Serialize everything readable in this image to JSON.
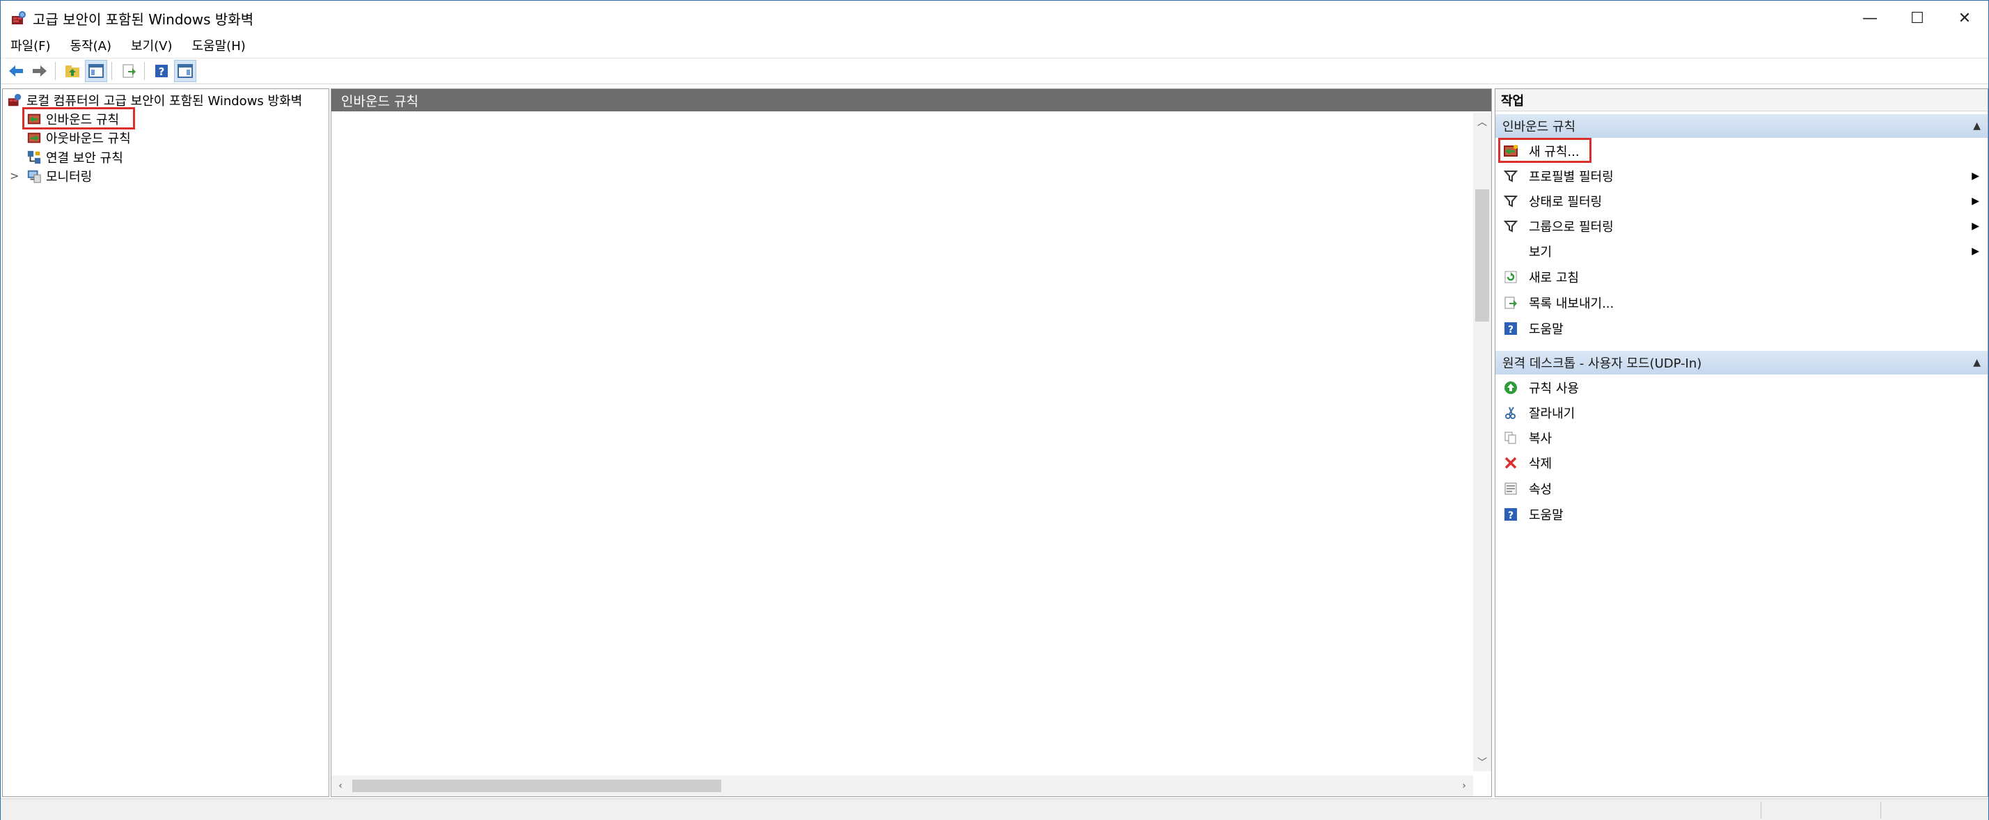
{
  "window": {
    "title": "고급 보안이 포함된 Windows 방화벽",
    "controls": {
      "minimize": "—",
      "maximize": "☐",
      "close": "✕"
    }
  },
  "menu": [
    "파일(F)",
    "동작(A)",
    "보기(V)",
    "도움말(H)"
  ],
  "tree": {
    "root": "로컬 컴퓨터의 고급 보안이 포함된 Windows 방화벽",
    "items": [
      {
        "label": "인바운드 규칙",
        "selected": true
      },
      {
        "label": "아웃바운드 규칙"
      },
      {
        "label": "연결 보안 규칙"
      },
      {
        "label": "모니터링",
        "expander": ">"
      }
    ]
  },
  "center": {
    "header": "인바운드 규칙"
  },
  "actions": {
    "title": "작업",
    "section1": {
      "title": "인바운드 규칙",
      "items": [
        {
          "label": "새 규칙...",
          "icon": "new-rule-icon"
        },
        {
          "label": "프로필별 필터링",
          "icon": "filter-icon",
          "submenu": "▶"
        },
        {
          "label": "상태로 필터링",
          "icon": "filter-icon",
          "submenu": "▶"
        },
        {
          "label": "그룹으로 필터링",
          "icon": "filter-icon",
          "submenu": "▶"
        },
        {
          "label": "보기",
          "icon": "",
          "submenu": "▶"
        },
        {
          "label": "새로 고침",
          "icon": "refresh-icon"
        },
        {
          "label": "목록 내보내기...",
          "icon": "export-icon"
        },
        {
          "label": "도움말",
          "icon": "help-icon"
        }
      ]
    },
    "section2": {
      "title": "원격 데스크톱 - 사용자 모드(UDP-In)",
      "items": [
        {
          "label": "규칙 사용",
          "icon": "enable-icon"
        },
        {
          "label": "잘라내기",
          "icon": "cut-icon"
        },
        {
          "label": "복사",
          "icon": "copy-icon"
        },
        {
          "label": "삭제",
          "icon": "delete-icon"
        },
        {
          "label": "속성",
          "icon": "properties-icon"
        },
        {
          "label": "도움말",
          "icon": "help-icon"
        }
      ]
    }
  },
  "colors": {
    "highlight": "#d9302c",
    "section_header": "#c5d8ee",
    "center_header": "#6e6e6e"
  }
}
